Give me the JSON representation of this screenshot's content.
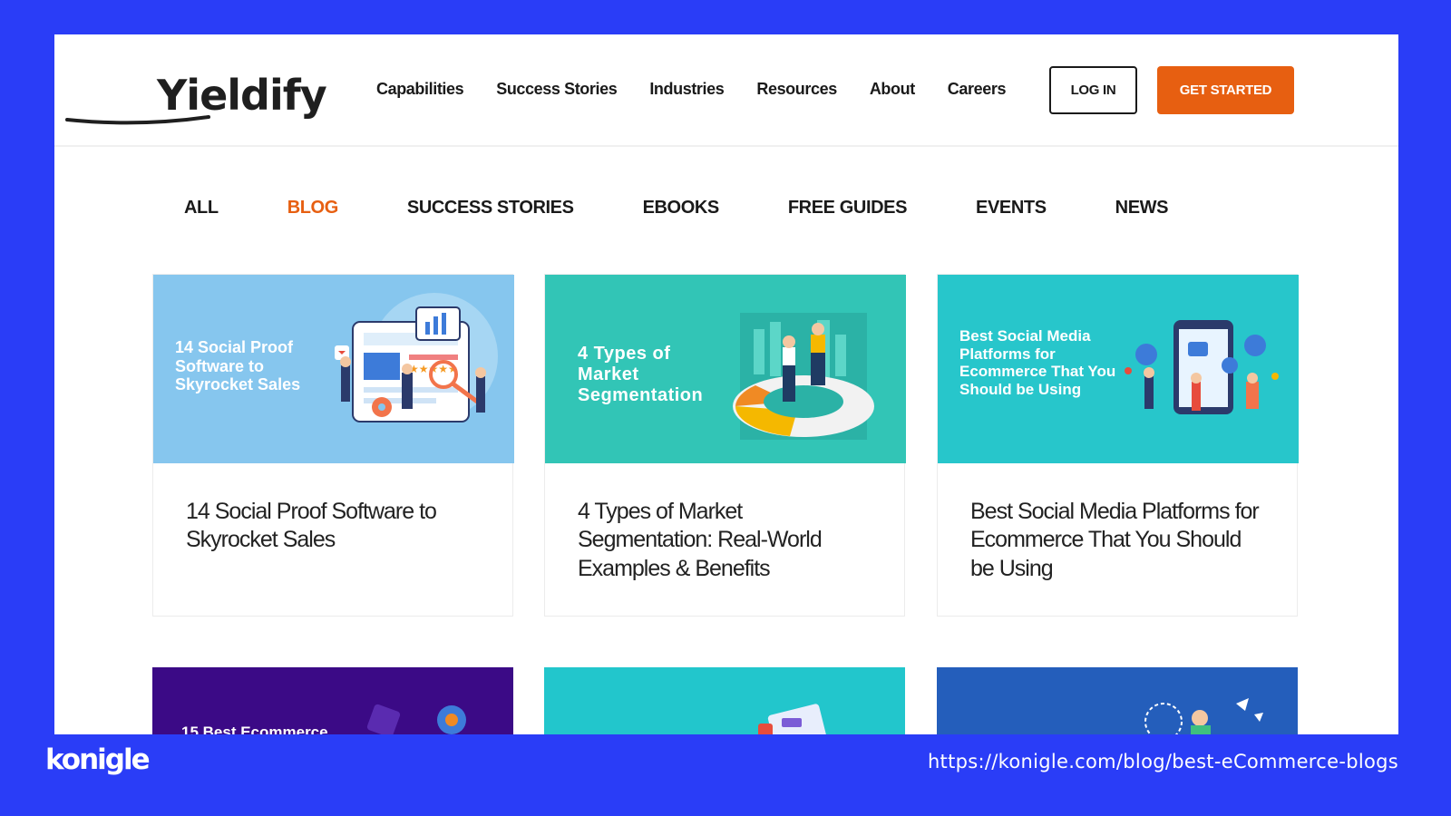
{
  "header": {
    "logo_text": "Yieldify",
    "nav": [
      "Capabilities",
      "Success Stories",
      "Industries",
      "Resources",
      "About",
      "Careers"
    ],
    "login_label": "LOG IN",
    "cta_label": "GET STARTED",
    "accent_color": "#e75f11"
  },
  "tabs": {
    "items": [
      "ALL",
      "BLOG",
      "SUCCESS STORIES",
      "EBOOKS",
      "FREE GUIDES",
      "EVENTS",
      "NEWS"
    ],
    "active": "BLOG"
  },
  "cards": [
    {
      "image_text": "14 Social Proof Software to Skyrocket Sales",
      "title": "14 Social Proof Software to Skyrocket Sales",
      "bg": "#86c6ee"
    },
    {
      "image_text": "4 Types of Market Segmentation",
      "title": "4 Types of Market Segmentation: Real-World Examples & Benefits",
      "bg": "#32c5b6"
    },
    {
      "image_text": "Best Social Media Platforms for Ecommerce That You Should be Using",
      "title": "Best Social Media Platforms for Ecommerce That You Should be Using",
      "bg": "#27c6cb"
    },
    {
      "image_text": "15 Best Ecommerce",
      "bg": "#3b0a86"
    },
    {
      "bg": "#22c6cc"
    },
    {
      "bg": "#245ebb"
    }
  ],
  "footer": {
    "brand": "konigle",
    "url": "https://konigle.com/blog/best-eCommerce-blogs"
  },
  "colors": {
    "page_background": "#2a3df7"
  }
}
